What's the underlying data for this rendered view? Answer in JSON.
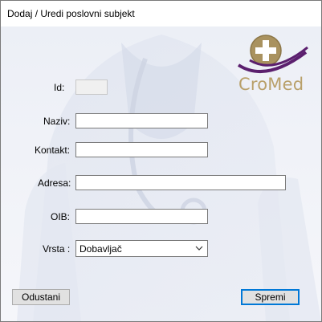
{
  "window": {
    "title": "Dodaj / Uredi poslovni subjekt"
  },
  "logo": {
    "text": "CroMed",
    "colors": {
      "gold": "#b9a06a",
      "purple": "#5b1f6e",
      "cross": "#ffffff"
    }
  },
  "form": {
    "id": {
      "label": "Id:",
      "value": ""
    },
    "naziv": {
      "label": "Naziv:",
      "value": ""
    },
    "kontakt": {
      "label": "Kontakt:",
      "value": ""
    },
    "adresa": {
      "label": "Adresa:",
      "value": ""
    },
    "oib": {
      "label": "OIB:",
      "value": ""
    },
    "vrsta": {
      "label": "Vrsta :",
      "selected": "Dobavljač"
    }
  },
  "buttons": {
    "cancel_label": "Odustani",
    "save_label": "Spremi"
  },
  "colors": {
    "accent": "#0078d7",
    "button_bg": "#e1e1e1",
    "background": "#eceff6"
  }
}
